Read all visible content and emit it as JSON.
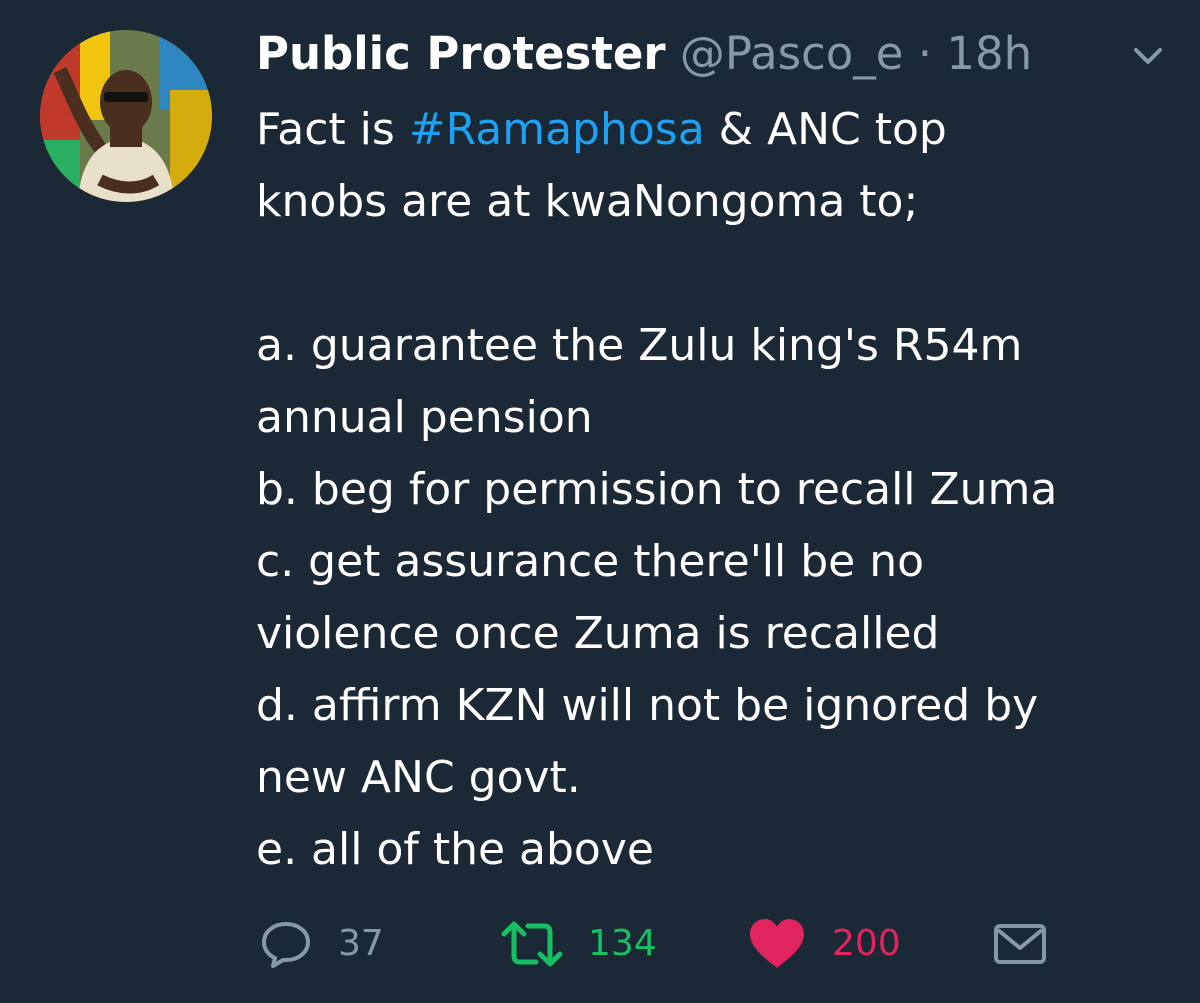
{
  "tweet": {
    "display_name": "Public Protester",
    "handle": "@Pasco_e",
    "separator": "·",
    "timestamp": "18h",
    "hashtag": "#Ramaphosa",
    "text_prefix": "Fact is ",
    "text_suffix": " & ANC top",
    "lines": [
      "knobs are at kwaNongoma to;",
      "",
      "",
      "a. guarantee the Zulu king's R54m",
      "annual pension",
      "b. beg for permission to recall Zuma",
      "c. get assurance there'll be no",
      "violence once Zuma is recalled",
      "d. affirm KZN will not be ignored by",
      "new ANC govt.",
      "e. all of the above"
    ]
  },
  "actions": {
    "reply_count": "37",
    "retweet_count": "134",
    "like_count": "200",
    "icons": [
      "reply-icon",
      "retweet-icon",
      "heart-icon",
      "envelope-icon"
    ]
  },
  "colors": {
    "background": "#1b2836",
    "text": "#ffffff",
    "muted": "#8899a6",
    "hashtag": "#1da1f2",
    "retweet": "#17bf63",
    "like": "#e0245e"
  }
}
